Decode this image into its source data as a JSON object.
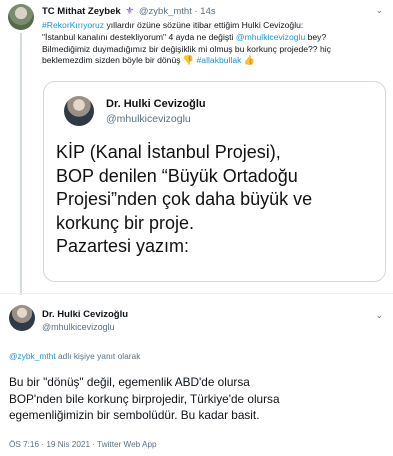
{
  "reply_tweet": {
    "author_name": "TC Mithat Zeybek",
    "author_badge": "⚜",
    "handle": "@zybk_mtht",
    "separator": "·",
    "time": "14s",
    "body": {
      "line1_hashtag": "#RekorKırıyoruz",
      "line1_text": " yıllardır özüne sözüne itibar ettiğim Hulki Cevizoğlu:",
      "line2_text": "\"İstanbul kanalını destekliyorum\" 4 ayda ne değişti ",
      "line2_mention": "@mhulkicevizoglu",
      "line2_tail": " bey?",
      "line3_text": "Bilmediğimiz duymadığımız bir değişiklik mi olmuş bu korkunç projede?? hiç",
      "line4_text": "beklemezdim sizden böyle bir dönüş ",
      "line4_emoji1": "👎",
      "line4_hashtag": "#allakbullak",
      "line4_emoji2": "👍"
    },
    "embedded_image": {
      "name": "Dr. Hulki Cevizoğlu",
      "handle": "@mhulkicevizoglu",
      "lines": [
        "KİP (Kanal İstanbul Projesi),",
        "BOP denilen “Büyük Ortadoğu",
        "Projesi”nden çok daha büyük ve",
        "korkunç bir proje.",
        "Pazartesi yazım:"
      ]
    }
  },
  "main_tweet": {
    "author_name": "Dr. Hulki Cevizoğlu",
    "handle": "@mhulkicevizoglu",
    "reply_to_mention": "@zybk_mtht",
    "reply_to_text": " adlı kişiye yanıt olarak",
    "lines": [
      "Bu bir \"dönüş\" değil, egemenlik ABD'de olursa",
      "BOP'nden bile korkunç birprojedir, Türkiye'de olursa",
      "egemenliğimizin bir sembolüdür. Bu kadar basit."
    ],
    "meta": "ÖS 7:16 · 19 Nis 2021 · Twitter Web App"
  },
  "icons": {
    "caret": "chevron-down-icon"
  }
}
